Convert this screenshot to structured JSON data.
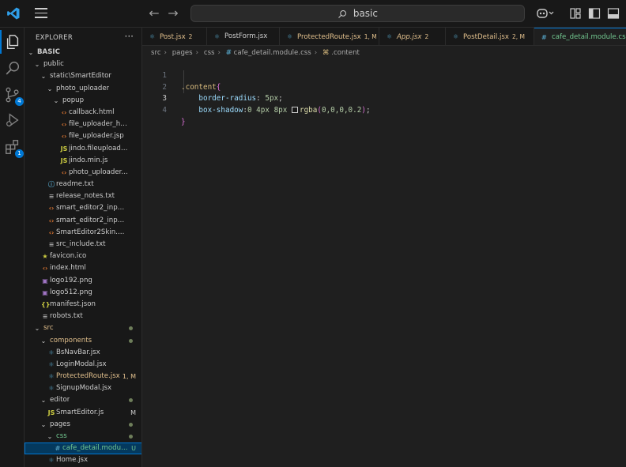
{
  "titlebar": {
    "search_text": "basic",
    "icons": [
      "vscode-logo-icon",
      "menu-icon",
      "back-arrow-icon",
      "forward-arrow-icon",
      "search-icon",
      "copilot-icon",
      "layout-icon",
      "toggle-sidebar-icon",
      "toggle-panel-icon"
    ]
  },
  "activity": {
    "items": [
      "explorer-icon",
      "search-icon",
      "source-control-icon",
      "run-debug-icon",
      "extensions-icon"
    ],
    "source_control_badge": "4",
    "extensions_badge": "1"
  },
  "explorer": {
    "title": "EXPLORER",
    "more": "···",
    "tree": [
      {
        "name": "BASIC",
        "depth": 0,
        "type": "folder",
        "open": true,
        "bold": true
      },
      {
        "name": "public",
        "depth": 1,
        "type": "folder",
        "open": true
      },
      {
        "name": "static\\SmartEditor",
        "depth": 2,
        "type": "folder",
        "open": true
      },
      {
        "name": "photo_uploader",
        "depth": 3,
        "type": "folder",
        "open": true
      },
      {
        "name": "popup",
        "depth": 4,
        "type": "folder",
        "open": true
      },
      {
        "name": "callback.html",
        "depth": 5,
        "type": "html"
      },
      {
        "name": "file_uploader_html5.jsp",
        "depth": 5,
        "type": "html"
      },
      {
        "name": "file_uploader.jsp",
        "depth": 5,
        "type": "html"
      },
      {
        "name": "jindo.fileuploader.js",
        "depth": 5,
        "type": "js"
      },
      {
        "name": "jindo.min.js",
        "depth": 5,
        "type": "js"
      },
      {
        "name": "photo_uploader.html",
        "depth": 5,
        "type": "html"
      },
      {
        "name": "readme.txt",
        "depth": 3,
        "type": "info"
      },
      {
        "name": "release_notes.txt",
        "depth": 3,
        "type": "txt"
      },
      {
        "name": "smart_editor2_inputarea_i...",
        "depth": 3,
        "type": "html"
      },
      {
        "name": "smart_editor2_inputarea.ht...",
        "depth": 3,
        "type": "html"
      },
      {
        "name": "SmartEditor2Skin.html",
        "depth": 3,
        "type": "html"
      },
      {
        "name": "src_include.txt",
        "depth": 3,
        "type": "txt"
      },
      {
        "name": "favicon.ico",
        "depth": 2,
        "type": "star"
      },
      {
        "name": "index.html",
        "depth": 2,
        "type": "html"
      },
      {
        "name": "logo192.png",
        "depth": 2,
        "type": "img"
      },
      {
        "name": "logo512.png",
        "depth": 2,
        "type": "img"
      },
      {
        "name": "manifest.json",
        "depth": 2,
        "type": "json"
      },
      {
        "name": "robots.txt",
        "depth": 2,
        "type": "txt"
      },
      {
        "name": "src",
        "depth": 1,
        "type": "folder",
        "open": true,
        "color": "#e2c08d",
        "dot": true
      },
      {
        "name": "components",
        "depth": 2,
        "type": "folder",
        "open": true,
        "color": "#e2c08d",
        "dot": true
      },
      {
        "name": "BsNavBar.jsx",
        "depth": 3,
        "type": "react"
      },
      {
        "name": "LoginModal.jsx",
        "depth": 3,
        "type": "react"
      },
      {
        "name": "ProtectedRoute.jsx",
        "depth": 3,
        "type": "react",
        "color": "#e2c08d",
        "status": "1, M",
        "status_color": "#e2c08d"
      },
      {
        "name": "SignupModal.jsx",
        "depth": 3,
        "type": "react"
      },
      {
        "name": "editor",
        "depth": 2,
        "type": "folder",
        "open": true,
        "dot": true
      },
      {
        "name": "SmartEditor.js",
        "depth": 3,
        "type": "js",
        "status": "M",
        "status_color": "#cccccc"
      },
      {
        "name": "pages",
        "depth": 2,
        "type": "folder",
        "open": true,
        "dot": true
      },
      {
        "name": "css",
        "depth": 3,
        "type": "folder",
        "open": true,
        "color": "#73c991",
        "dot": true
      },
      {
        "name": "cafe_detail.module.c...",
        "depth": 4,
        "type": "css",
        "color": "#73c991",
        "status": "U",
        "status_color": "#73c991",
        "selected": true
      },
      {
        "name": "Home.jsx",
        "depth": 3,
        "type": "react"
      }
    ]
  },
  "tabs": [
    {
      "label": "Post.jsx",
      "badge": "2",
      "type": "react",
      "color": "#e2c08d",
      "italic": false
    },
    {
      "label": "PostForm.jsx",
      "badge": "",
      "type": "react",
      "color": "#cccccc",
      "italic": false
    },
    {
      "label": "ProtectedRoute.jsx",
      "badge": "1, M",
      "type": "react",
      "color": "#e2c08d",
      "italic": false
    },
    {
      "label": "App.jsx",
      "badge": "2",
      "type": "react",
      "color": "#e2c08d",
      "italic": true
    },
    {
      "label": "PostDetail.jsx",
      "badge": "2, M",
      "type": "react",
      "color": "#e2c08d",
      "italic": false
    },
    {
      "label": "cafe_detail.module.css",
      "badge": "",
      "type": "css",
      "color": "#73c991",
      "italic": false,
      "active": true
    }
  ],
  "breadcrumb": [
    "src",
    "pages",
    "css",
    "cafe_detail.module.css",
    ".content"
  ],
  "code": {
    "line_numbers": [
      "1",
      "2",
      "3",
      "4"
    ],
    "line1_selector": ".content",
    "line1_brace": "{",
    "line2_prop": "border-radius",
    "line2_value": "5px",
    "line3_prop": "box-shadow",
    "line3_value_nums": "0 4px 8px",
    "line3_fn": "rgba",
    "line3_args": "0,0,0,0.2",
    "line4_brace": "}"
  },
  "colors": {
    "accent": "#0078d4",
    "modified": "#e2c08d",
    "untracked": "#73c991",
    "annotation": "#e51400"
  }
}
